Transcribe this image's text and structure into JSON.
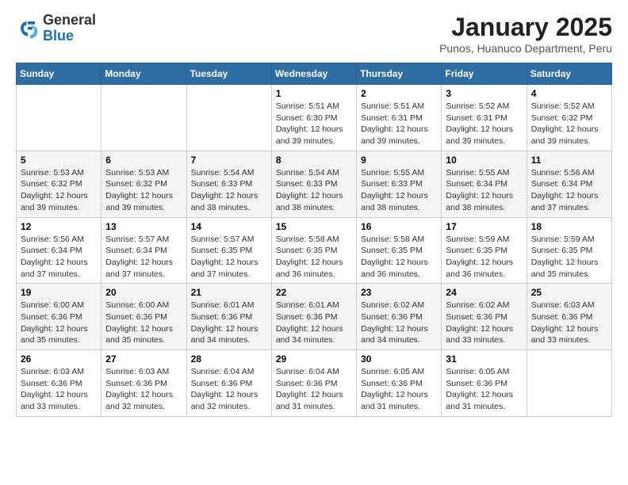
{
  "header": {
    "logo_general": "General",
    "logo_blue": "Blue",
    "month_title": "January 2025",
    "location": "Punos, Huanuco Department, Peru"
  },
  "days_of_week": [
    "Sunday",
    "Monday",
    "Tuesday",
    "Wednesday",
    "Thursday",
    "Friday",
    "Saturday"
  ],
  "weeks": [
    [
      {
        "day": "",
        "info": ""
      },
      {
        "day": "",
        "info": ""
      },
      {
        "day": "",
        "info": ""
      },
      {
        "day": "1",
        "info": "Sunrise: 5:51 AM\nSunset: 6:30 PM\nDaylight: 12 hours\nand 39 minutes."
      },
      {
        "day": "2",
        "info": "Sunrise: 5:51 AM\nSunset: 6:31 PM\nDaylight: 12 hours\nand 39 minutes."
      },
      {
        "day": "3",
        "info": "Sunrise: 5:52 AM\nSunset: 6:31 PM\nDaylight: 12 hours\nand 39 minutes."
      },
      {
        "day": "4",
        "info": "Sunrise: 5:52 AM\nSunset: 6:32 PM\nDaylight: 12 hours\nand 39 minutes."
      }
    ],
    [
      {
        "day": "5",
        "info": "Sunrise: 5:53 AM\nSunset: 6:32 PM\nDaylight: 12 hours\nand 39 minutes."
      },
      {
        "day": "6",
        "info": "Sunrise: 5:53 AM\nSunset: 6:32 PM\nDaylight: 12 hours\nand 39 minutes."
      },
      {
        "day": "7",
        "info": "Sunrise: 5:54 AM\nSunset: 6:33 PM\nDaylight: 12 hours\nand 38 minutes."
      },
      {
        "day": "8",
        "info": "Sunrise: 5:54 AM\nSunset: 6:33 PM\nDaylight: 12 hours\nand 38 minutes."
      },
      {
        "day": "9",
        "info": "Sunrise: 5:55 AM\nSunset: 6:33 PM\nDaylight: 12 hours\nand 38 minutes."
      },
      {
        "day": "10",
        "info": "Sunrise: 5:55 AM\nSunset: 6:34 PM\nDaylight: 12 hours\nand 38 minutes."
      },
      {
        "day": "11",
        "info": "Sunrise: 5:56 AM\nSunset: 6:34 PM\nDaylight: 12 hours\nand 37 minutes."
      }
    ],
    [
      {
        "day": "12",
        "info": "Sunrise: 5:56 AM\nSunset: 6:34 PM\nDaylight: 12 hours\nand 37 minutes."
      },
      {
        "day": "13",
        "info": "Sunrise: 5:57 AM\nSunset: 6:34 PM\nDaylight: 12 hours\nand 37 minutes."
      },
      {
        "day": "14",
        "info": "Sunrise: 5:57 AM\nSunset: 6:35 PM\nDaylight: 12 hours\nand 37 minutes."
      },
      {
        "day": "15",
        "info": "Sunrise: 5:58 AM\nSunset: 6:35 PM\nDaylight: 12 hours\nand 36 minutes."
      },
      {
        "day": "16",
        "info": "Sunrise: 5:58 AM\nSunset: 6:35 PM\nDaylight: 12 hours\nand 36 minutes."
      },
      {
        "day": "17",
        "info": "Sunrise: 5:59 AM\nSunset: 6:35 PM\nDaylight: 12 hours\nand 36 minutes."
      },
      {
        "day": "18",
        "info": "Sunrise: 5:59 AM\nSunset: 6:35 PM\nDaylight: 12 hours\nand 35 minutes."
      }
    ],
    [
      {
        "day": "19",
        "info": "Sunrise: 6:00 AM\nSunset: 6:36 PM\nDaylight: 12 hours\nand 35 minutes."
      },
      {
        "day": "20",
        "info": "Sunrise: 6:00 AM\nSunset: 6:36 PM\nDaylight: 12 hours\nand 35 minutes."
      },
      {
        "day": "21",
        "info": "Sunrise: 6:01 AM\nSunset: 6:36 PM\nDaylight: 12 hours\nand 34 minutes."
      },
      {
        "day": "22",
        "info": "Sunrise: 6:01 AM\nSunset: 6:36 PM\nDaylight: 12 hours\nand 34 minutes."
      },
      {
        "day": "23",
        "info": "Sunrise: 6:02 AM\nSunset: 6:36 PM\nDaylight: 12 hours\nand 34 minutes."
      },
      {
        "day": "24",
        "info": "Sunrise: 6:02 AM\nSunset: 6:36 PM\nDaylight: 12 hours\nand 33 minutes."
      },
      {
        "day": "25",
        "info": "Sunrise: 6:03 AM\nSunset: 6:36 PM\nDaylight: 12 hours\nand 33 minutes."
      }
    ],
    [
      {
        "day": "26",
        "info": "Sunrise: 6:03 AM\nSunset: 6:36 PM\nDaylight: 12 hours\nand 33 minutes."
      },
      {
        "day": "27",
        "info": "Sunrise: 6:03 AM\nSunset: 6:36 PM\nDaylight: 12 hours\nand 32 minutes."
      },
      {
        "day": "28",
        "info": "Sunrise: 6:04 AM\nSunset: 6:36 PM\nDaylight: 12 hours\nand 32 minutes."
      },
      {
        "day": "29",
        "info": "Sunrise: 6:04 AM\nSunset: 6:36 PM\nDaylight: 12 hours\nand 31 minutes."
      },
      {
        "day": "30",
        "info": "Sunrise: 6:05 AM\nSunset: 6:36 PM\nDaylight: 12 hours\nand 31 minutes."
      },
      {
        "day": "31",
        "info": "Sunrise: 6:05 AM\nSunset: 6:36 PM\nDaylight: 12 hours\nand 31 minutes."
      },
      {
        "day": "",
        "info": ""
      }
    ]
  ]
}
